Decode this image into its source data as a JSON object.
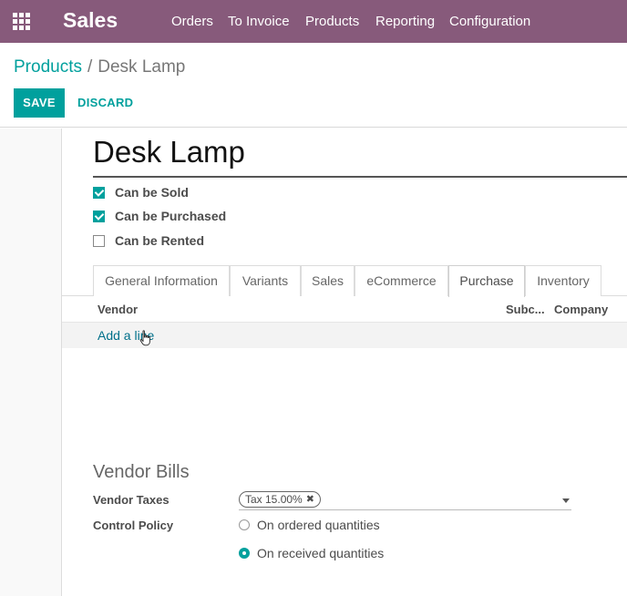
{
  "navbar": {
    "app_name": "Sales",
    "menu": [
      "Orders",
      "To Invoice",
      "Products",
      "Reporting",
      "Configuration"
    ],
    "background": "#875a7b"
  },
  "breadcrumb": {
    "parent": "Products",
    "separator": "/",
    "current": "Desk Lamp"
  },
  "actions": {
    "save": "SAVE",
    "discard": "DISCARD"
  },
  "product": {
    "name": "Desk Lamp",
    "checkboxes": [
      {
        "label": "Can be Sold",
        "checked": true
      },
      {
        "label": "Can be Purchased",
        "checked": true
      },
      {
        "label": "Can be Rented",
        "checked": false
      }
    ]
  },
  "tabs": [
    "General Information",
    "Variants",
    "Sales",
    "eCommerce",
    "Purchase",
    "Inventory"
  ],
  "active_tab": "Purchase",
  "vendor_table": {
    "columns": [
      "Vendor",
      "Subc...",
      "Company"
    ],
    "add_line": "Add a line"
  },
  "vendor_bills": {
    "title": "Vendor Bills",
    "taxes_label": "Vendor Taxes",
    "tax_tag": "Tax 15.00%",
    "tax_remove_glyph": "✖",
    "policy_label": "Control Policy",
    "policy_options": [
      {
        "label": "On ordered quantities",
        "selected": false
      },
      {
        "label": "On received quantities",
        "selected": true
      }
    ]
  },
  "colors": {
    "accent": "#00a09d",
    "link": "#00708a"
  },
  "icons": {
    "apps": "grid-icon",
    "cursor": "hand-pointer-icon",
    "caret": "caret-down-icon",
    "remove": "close-icon"
  }
}
